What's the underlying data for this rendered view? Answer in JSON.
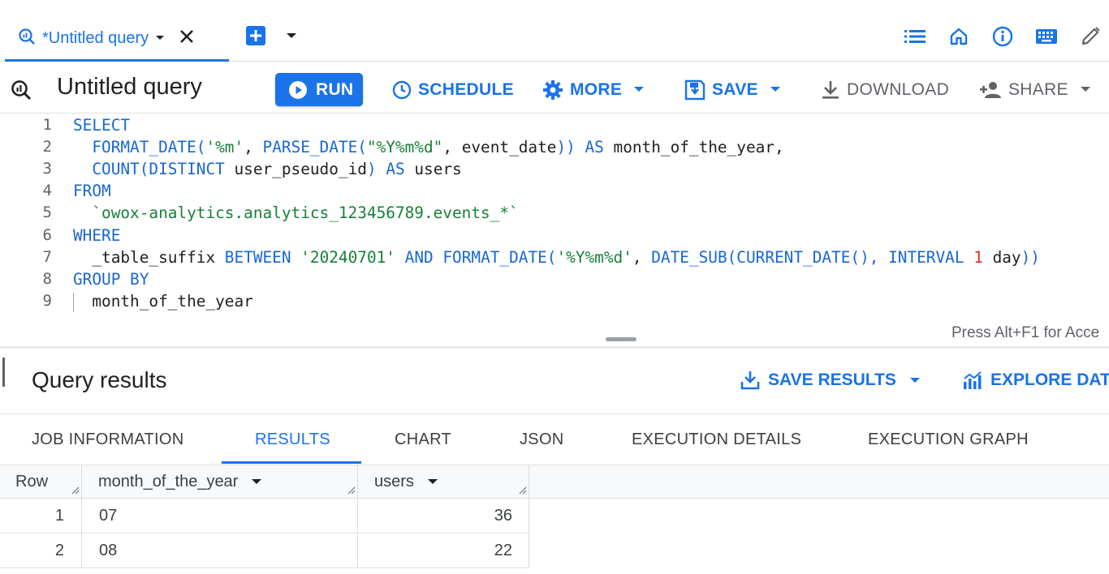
{
  "tab": {
    "title": "*Untitled query"
  },
  "toolbar": {
    "query_title": "Untitled query",
    "run_label": "RUN",
    "schedule_label": "SCHEDULE",
    "more_label": "MORE",
    "save_label": "SAVE",
    "download_label": "DOWNLOAD",
    "share_label": "SHARE"
  },
  "editor": {
    "line_numbers": [
      "1",
      "2",
      "3",
      "4",
      "5",
      "6",
      "7",
      "8",
      "9"
    ],
    "lines": [
      [
        {
          "t": "SELECT",
          "c": "kw"
        }
      ],
      [
        {
          "t": "  "
        },
        {
          "t": "FORMAT_DATE(",
          "c": "kw"
        },
        {
          "t": "'%m'",
          "c": "str"
        },
        {
          "t": ", "
        },
        {
          "t": "PARSE_DATE(",
          "c": "kw"
        },
        {
          "t": "\"%Y%m%d\"",
          "c": "str"
        },
        {
          "t": ", event_date"
        },
        {
          "t": "))",
          "c": "kw"
        },
        {
          "t": " "
        },
        {
          "t": "AS",
          "c": "kw"
        },
        {
          "t": " month_of_the_year,"
        }
      ],
      [
        {
          "t": "  "
        },
        {
          "t": "COUNT(DISTINCT",
          "c": "kw"
        },
        {
          "t": " user_pseudo_id"
        },
        {
          "t": ")",
          "c": "kw"
        },
        {
          "t": " "
        },
        {
          "t": "AS",
          "c": "kw"
        },
        {
          "t": " users"
        }
      ],
      [
        {
          "t": "FROM",
          "c": "kw"
        }
      ],
      [
        {
          "t": "  "
        },
        {
          "t": "`owox-analytics.analytics_123456789.events_*`",
          "c": "str"
        }
      ],
      [
        {
          "t": "WHERE",
          "c": "kw"
        }
      ],
      [
        {
          "t": "  _table_suffix "
        },
        {
          "t": "BETWEEN",
          "c": "kw"
        },
        {
          "t": " "
        },
        {
          "t": "'20240701'",
          "c": "str"
        },
        {
          "t": " "
        },
        {
          "t": "AND",
          "c": "kw"
        },
        {
          "t": " "
        },
        {
          "t": "FORMAT_DATE(",
          "c": "kw"
        },
        {
          "t": "'%Y%m%d'",
          "c": "str"
        },
        {
          "t": ", "
        },
        {
          "t": "DATE_SUB(CURRENT_DATE(),",
          "c": "kw"
        },
        {
          "t": " "
        },
        {
          "t": "INTERVAL",
          "c": "kw"
        },
        {
          "t": " "
        },
        {
          "t": "1",
          "c": "num"
        },
        {
          "t": " day"
        },
        {
          "t": "))",
          "c": "kw"
        }
      ],
      [
        {
          "t": "GROUP BY",
          "c": "kw"
        }
      ],
      [
        {
          "t": "  month_of_the_year"
        }
      ]
    ],
    "access_hint": "Press Alt+F1 for Acce"
  },
  "results": {
    "title": "Query results",
    "save_results_label": "SAVE RESULTS",
    "explore_data_label": "EXPLORE DATA",
    "tabs": [
      "JOB INFORMATION",
      "RESULTS",
      "CHART",
      "JSON",
      "EXECUTION DETAILS",
      "EXECUTION GRAPH"
    ],
    "active_tab": "RESULTS",
    "columns": {
      "row": "Row",
      "month": "month_of_the_year",
      "users": "users"
    },
    "rows": [
      {
        "row": "1",
        "month_of_the_year": "07",
        "users": "36"
      },
      {
        "row": "2",
        "month_of_the_year": "08",
        "users": "22"
      }
    ]
  },
  "icons": {
    "tab": "query-icon",
    "top_bar": [
      "list-icon",
      "home-icon",
      "info-icon",
      "keyboard-icon",
      "edit-icon"
    ]
  },
  "colors": {
    "accent": "#1a73e8",
    "keyword": "#1967d2",
    "string": "#188038",
    "number": "#d93025"
  }
}
